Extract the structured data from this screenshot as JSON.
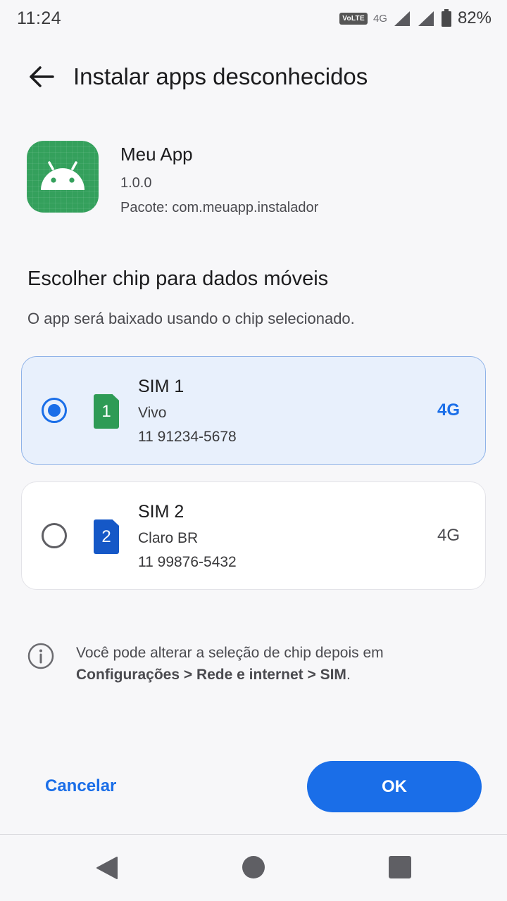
{
  "status_bar": {
    "time": "11:24",
    "volte": "VoLTE",
    "network": "4G",
    "battery": "82%"
  },
  "header": {
    "title": "Instalar apps desconhecidos"
  },
  "app": {
    "name": "Meu App",
    "version": "1.0.0",
    "package": "Pacote: com.meuapp.instalador",
    "icon": "android-icon",
    "icon_color": "#34a05c"
  },
  "section": {
    "title": "Escolher chip para dados móveis",
    "subtitle": "O app será baixado usando o chip selecionado."
  },
  "sims": [
    {
      "name": "SIM 1",
      "carrier": "Vivo",
      "number": "11 91234-5678",
      "network": "4G",
      "slot": "1",
      "chip_color": "#2e9b55",
      "selected": true
    },
    {
      "name": "SIM 2",
      "carrier": "Claro BR",
      "number": "11 99876-5432",
      "network": "4G",
      "slot": "2",
      "chip_color": "#1558c7",
      "selected": false
    }
  ],
  "info": {
    "prefix": "Você pode alterar a seleção de chip depois em",
    "path": "Configurações > Rede e internet > SIM",
    "suffix": "."
  },
  "actions": {
    "cancel": "Cancelar",
    "ok": "OK"
  },
  "colors": {
    "accent": "#1a6ee8",
    "selected_bg": "#e8f0fc"
  }
}
